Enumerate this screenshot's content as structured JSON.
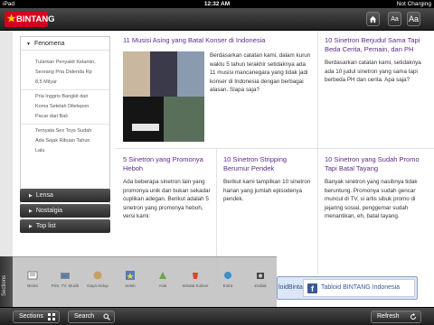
{
  "status": {
    "carrier": "iPad",
    "time": "12:32 AM",
    "charging": "Not Charging"
  },
  "app": {
    "logo": "BINTANG"
  },
  "toolbar": {
    "home_icon": "home-icon",
    "font_small": "Aa",
    "font_large": "Aa"
  },
  "menu": {
    "title": "Fenomena",
    "items": [
      "Tularkan Penyakit Kelamin, Seorang Pria Didenda Rp 8,5 Milyar",
      "Pria Inggris Bangkit dari Koma Setelah Ditelepon Pacar dari Bali",
      "Ternyata Sex Toys Sudah Ada Sejak Ribuan Tahun Lalu"
    ],
    "sections": [
      "Lensa",
      "Nostalgia",
      "Top list"
    ]
  },
  "articles": [
    {
      "title": "11 Musisi Asing yang Batal Konser di Indonesia",
      "body": "Berdasarkan catatan kami, dalam kurun waktu 5 tahun terakhir setidaknya ada 11 musisi mancanegara yang tidak jadi konser di Indonesia dengan berbagai alasan. Siapa saja?"
    },
    {
      "title": "10 Sinetron Berjudul Sama Tapi Beda Cerita, Pemain, dan PH",
      "body": "Berdasarkan catatan kami, setidaknya ada 10 judul sinetron yang sama tapi berbeda PH dan cerita. Apa saja?"
    },
    {
      "title": "5 Sinetron yang Promonya Heboh",
      "body": "Ada beberapa sinetron lain yang promonya unik dan bukan sekadar cuplikan adegan. Berikut adalah 5 sinetron yang promonya heboh, versi kami:"
    },
    {
      "title": "10 Sinetron Stripping Berumur Pendek",
      "body": "Berikut kami tampilkan 10 sinetron harian yang jumlah episodenya pendek."
    },
    {
      "title": "10 Sinetron yang Sudah Promo Tapi Batal Tayang",
      "body": "Banyak sinetron yang nasibnya tidak beruntung. Promonya sudah gencar muncul di TV, si artis sibuk promo di jejaring sosial, penggemar sudah menantikan, eh, batal tayang."
    }
  ],
  "dock": {
    "tab_label": "Sections",
    "items": [
      {
        "label": "Berita",
        "icon": "newspaper-icon"
      },
      {
        "label": "Film, TV, Musik",
        "icon": "film-icon"
      },
      {
        "label": "Gaya Hidup",
        "icon": "lifestyle-icon"
      },
      {
        "label": "Seleb",
        "icon": "star-icon"
      },
      {
        "label": "Asia",
        "icon": "globe-icon"
      },
      {
        "label": "Wisata Kuliner",
        "icon": "food-icon"
      },
      {
        "label": "Extra",
        "icon": "extra-icon"
      },
      {
        "label": "Zodiak",
        "icon": "zodiac-icon"
      }
    ]
  },
  "facebook": {
    "cut_text": "loidBintang",
    "label": "Tabloid BINTANG Indonesia"
  },
  "bottombar": {
    "sections": "Sections",
    "search": "Search",
    "refresh": "Refresh"
  }
}
